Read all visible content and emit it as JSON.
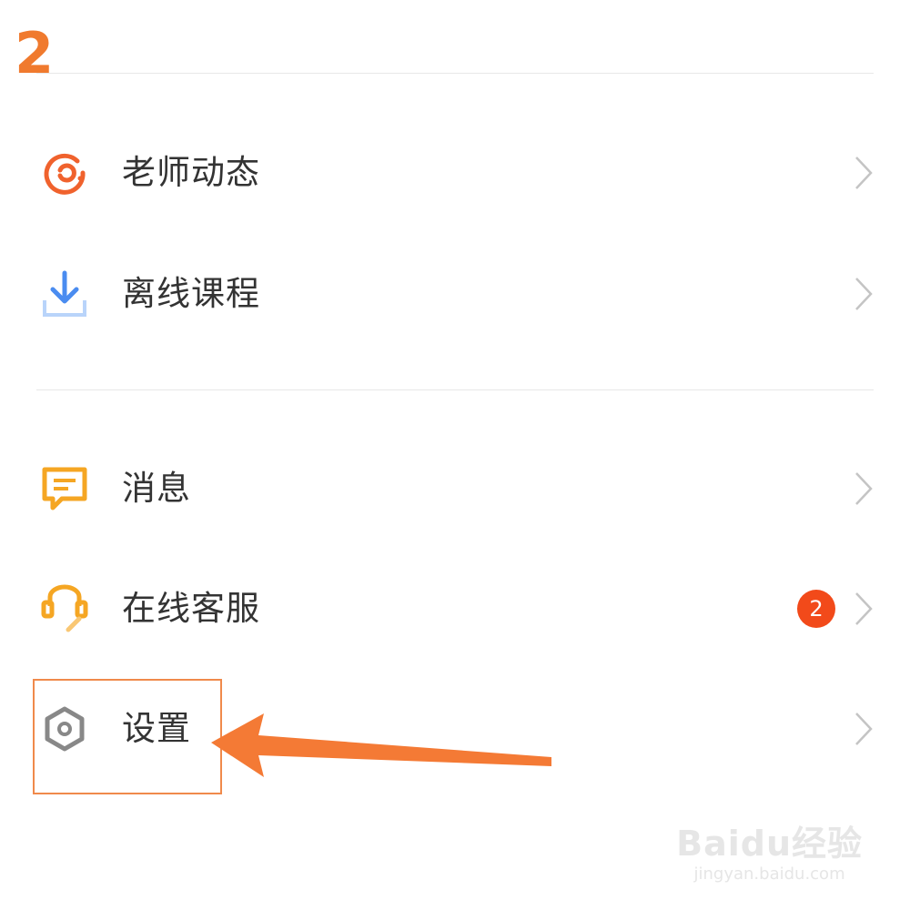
{
  "step_number": "2",
  "menu": {
    "section1": [
      {
        "label": "老师动态",
        "icon": "teacher-moments-icon"
      },
      {
        "label": "离线课程",
        "icon": "download-icon"
      }
    ],
    "section2": [
      {
        "label": "消息",
        "icon": "message-icon"
      },
      {
        "label": "在线客服",
        "icon": "headset-icon",
        "badge": "2"
      },
      {
        "label": "设置",
        "icon": "settings-icon"
      }
    ]
  },
  "colors": {
    "accent": "#f07a2e",
    "badge": "#f24a1a",
    "teacher_icon": "#f0622d",
    "download_icon": "#4a8cf0",
    "message_icon": "#f5a623",
    "headset_icon": "#f5a623",
    "settings_icon": "#888888"
  },
  "watermark": {
    "brand": "Baidu经验",
    "url": "jingyan.baidu.com"
  }
}
